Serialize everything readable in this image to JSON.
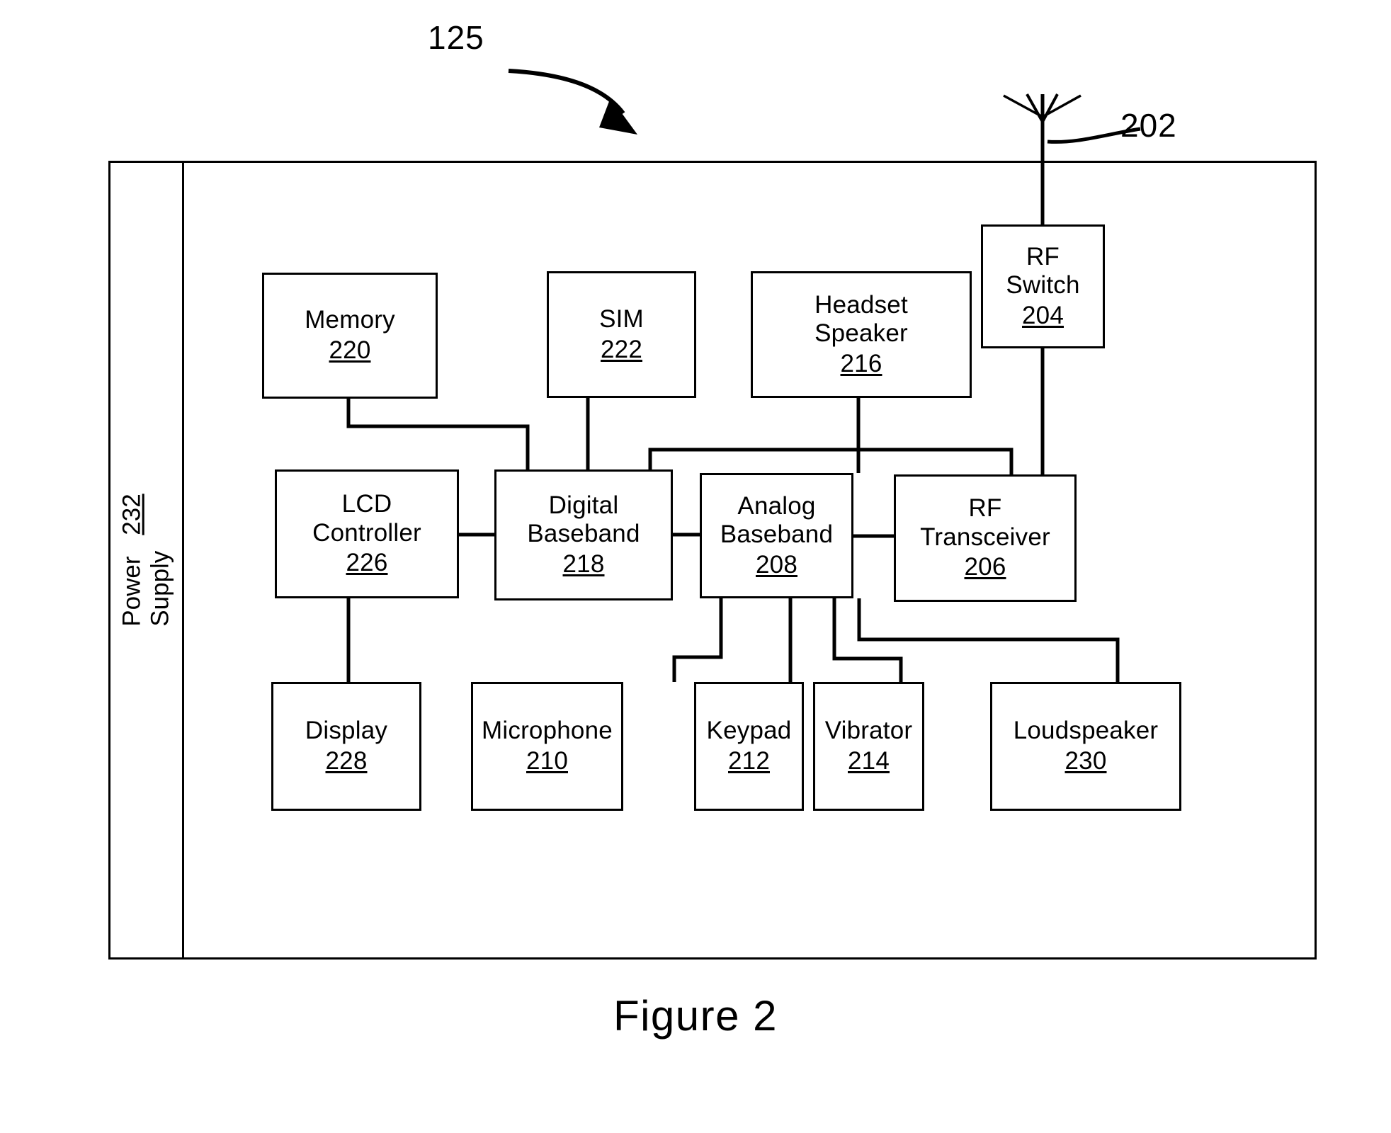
{
  "figure": {
    "caption": "Figure 2",
    "device_ref": "125",
    "antenna_ref": "202"
  },
  "power_supply": {
    "label": "Power Supply",
    "ref": "232"
  },
  "nodes": {
    "rf_switch": {
      "label": "RF\nSwitch",
      "ref": "204"
    },
    "memory": {
      "label": "Memory",
      "ref": "220"
    },
    "sim": {
      "label": "SIM",
      "ref": "222"
    },
    "headset_speaker": {
      "label": "Headset\nSpeaker",
      "ref": "216"
    },
    "lcd_controller": {
      "label": "LCD\nController",
      "ref": "226"
    },
    "digital_baseband": {
      "label": "Digital\nBaseband",
      "ref": "218"
    },
    "analog_baseband": {
      "label": "Analog\nBaseband",
      "ref": "208"
    },
    "rf_transceiver": {
      "label": "RF\nTransceiver",
      "ref": "206"
    },
    "display": {
      "label": "Display",
      "ref": "228"
    },
    "microphone": {
      "label": "Microphone",
      "ref": "210"
    },
    "keypad": {
      "label": "Keypad",
      "ref": "212"
    },
    "vibrator": {
      "label": "Vibrator",
      "ref": "214"
    },
    "loudspeaker": {
      "label": "Loudspeaker",
      "ref": "230"
    }
  },
  "colors": {
    "ink": "#000000",
    "paper": "#ffffff"
  }
}
